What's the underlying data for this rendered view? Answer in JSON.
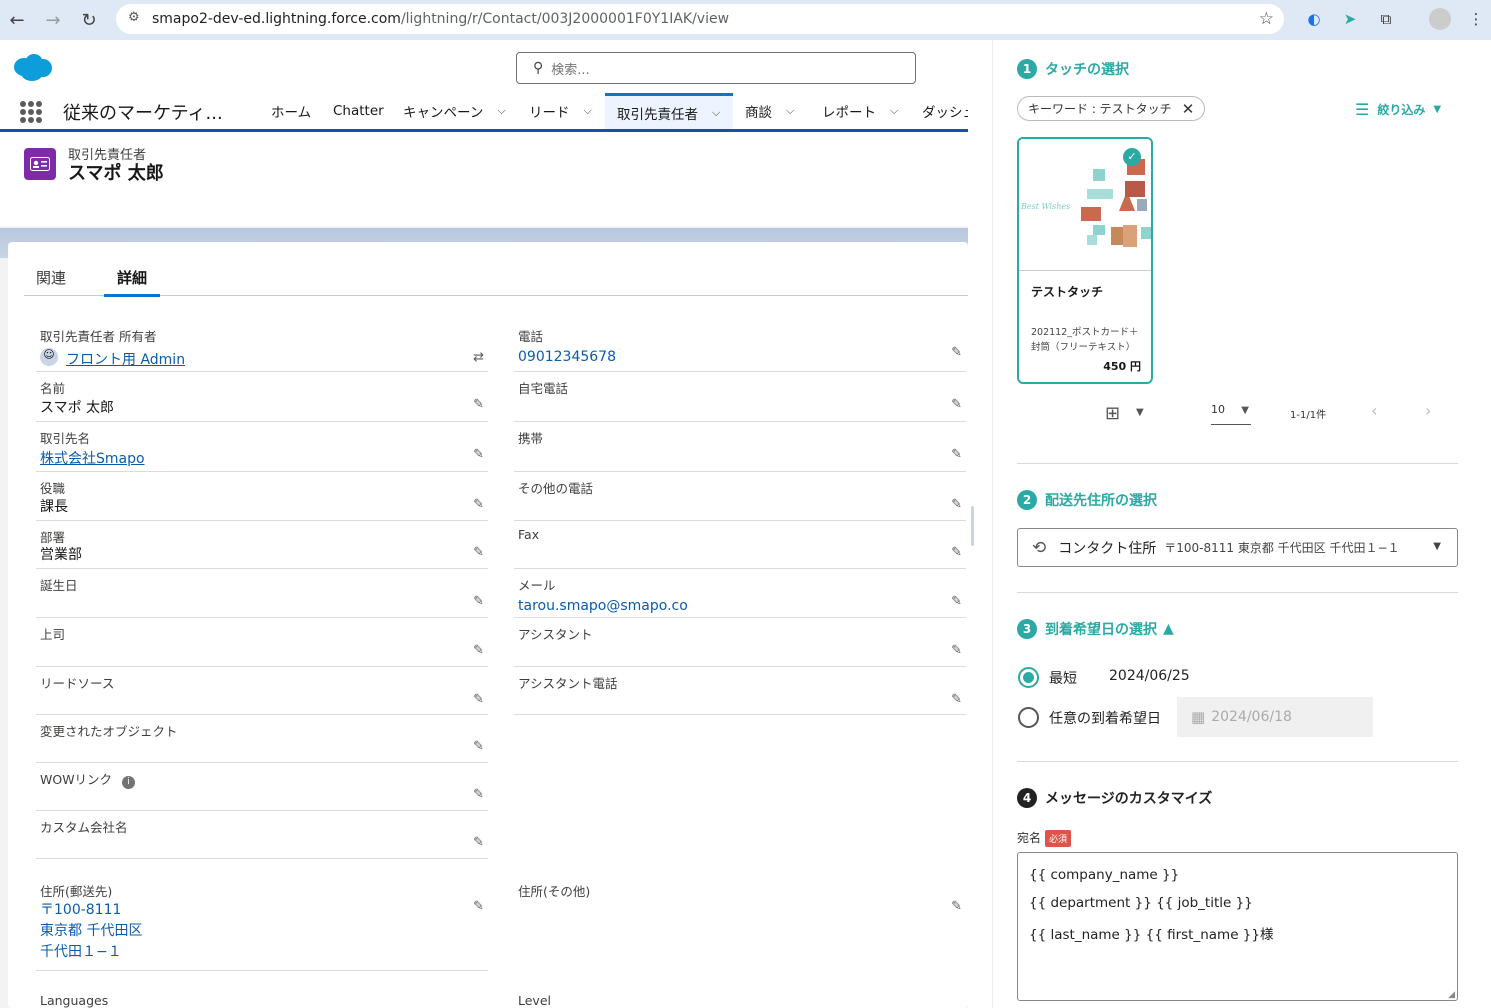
{
  "browser": {
    "url_host": "smapo2-dev-ed.lightning.force.com",
    "url_path": "/lightning/r/Contact/003J2000001F0Y1IAK/view"
  },
  "sf": {
    "search_placeholder": "検索...",
    "app_name": "従来のマーケティ...",
    "nav": [
      {
        "label": "ホーム"
      },
      {
        "label": "Chatter"
      },
      {
        "label": "キャンペーン"
      },
      {
        "label": "リード"
      },
      {
        "label": "取引先責任者"
      },
      {
        "label": "商談"
      },
      {
        "label": "レポート"
      },
      {
        "label": "ダッシュ"
      }
    ],
    "object_label": "取引先責任者",
    "record_name": "スマポ 太郎",
    "tabs": {
      "related": "関連",
      "detail": "詳細"
    },
    "left_fields": [
      {
        "label": "取引先責任者 所有者",
        "value": "フロント用 Admin"
      },
      {
        "label": "名前",
        "value": "スマポ 太郎"
      },
      {
        "label": "取引先名",
        "value": "株式会社Smapo"
      },
      {
        "label": "役職",
        "value": "課長"
      },
      {
        "label": "部署",
        "value": "営業部"
      },
      {
        "label": "誕生日",
        "value": ""
      },
      {
        "label": "上司",
        "value": ""
      },
      {
        "label": "リードソース",
        "value": ""
      },
      {
        "label": "変更されたオブジェクト",
        "value": ""
      },
      {
        "label": "WOWリンク",
        "value": ""
      },
      {
        "label": "カスタム会社名",
        "value": ""
      },
      {
        "label": "住所(郵送先)",
        "value": "〒100-8111",
        "value2": "東京都 千代田区",
        "value3": "千代田１−１"
      },
      {
        "label": "Languages",
        "value": ""
      }
    ],
    "right_fields": [
      {
        "label": "電話",
        "value": "09012345678"
      },
      {
        "label": "自宅電話",
        "value": ""
      },
      {
        "label": "携帯",
        "value": ""
      },
      {
        "label": "その他の電話",
        "value": ""
      },
      {
        "label": "Fax",
        "value": ""
      },
      {
        "label": "メール",
        "value": "tarou.smapo@smapo.co"
      },
      {
        "label": "アシスタント",
        "value": ""
      },
      {
        "label": "アシスタント電話",
        "value": ""
      },
      {
        "label": "住所(その他)",
        "value": ""
      },
      {
        "label": "Level",
        "value": ""
      }
    ]
  },
  "panel": {
    "step1": {
      "num": "1",
      "title": "タッチの選択"
    },
    "chip": "キーワード : テストタッチ",
    "filter": "絞り込み",
    "touch": {
      "title": "テストタッチ",
      "desc": "202112_ポストカード＋封筒（フリーテキスト）",
      "price": "450 円",
      "card_text": "Best Wishes"
    },
    "pager": {
      "per_page": "10",
      "range": "1-1/1件"
    },
    "step2": {
      "num": "2",
      "title": "配送先住所の選択"
    },
    "address": {
      "label": "コンタクト住所",
      "detail": "〒100-8111 東京都 千代田区 千代田１−１"
    },
    "step3": {
      "num": "3",
      "title": "到着希望日の選択"
    },
    "opt_shortest": {
      "label": "最短",
      "date": "2024/06/25"
    },
    "opt_any": {
      "label": "任意の到着希望日",
      "date": "2024/06/18"
    },
    "step4": {
      "num": "4",
      "title": "メッセージのカスタマイズ"
    },
    "recipient_label": "宛名",
    "required_badge": "必須",
    "message_lines": [
      "{{ company_name }}",
      "{{ department }}  {{ job_title }}",
      "{{ last_name }} {{ first_name }}様"
    ]
  },
  "colors": {
    "accent": "#2ba9a4",
    "sf_blue": "#0176d3",
    "link": "#0b5cab"
  }
}
